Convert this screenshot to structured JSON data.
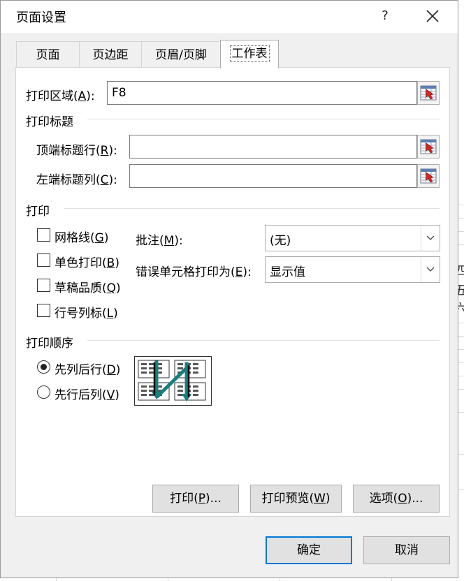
{
  "dialog": {
    "title": "页面设置",
    "help": "?",
    "close": "✕"
  },
  "tabs": [
    {
      "label": "页面"
    },
    {
      "label": "页边距"
    },
    {
      "label": "页眉/页脚"
    },
    {
      "label": "工作表"
    }
  ],
  "active_tab": "工作表",
  "print_area": {
    "label_pre": "打印区域(",
    "label_key": "A",
    "label_post": "):",
    "value": "F8"
  },
  "print_titles": {
    "heading": "打印标题",
    "rows_label_pre": "顶端标题行(",
    "rows_label_key": "R",
    "rows_label_post": "):",
    "rows_value": "",
    "cols_label_pre": "左端标题列(",
    "cols_label_key": "C",
    "cols_label_post": "):",
    "cols_value": ""
  },
  "print": {
    "heading": "打印",
    "gridlines": {
      "pre": "网格线(",
      "key": "G",
      "post": ")",
      "checked": false
    },
    "black_white": {
      "pre": "单色打印(",
      "key": "B",
      "post": ")",
      "checked": false
    },
    "draft": {
      "pre": "草稿品质(",
      "key": "Q",
      "post": ")",
      "checked": false
    },
    "headings": {
      "pre": "行号列标(",
      "key": "L",
      "post": ")",
      "checked": false
    },
    "comments_label_pre": "批注(",
    "comments_label_key": "M",
    "comments_label_post": "):",
    "comments_value": "(无)",
    "errors_label_pre": "错误单元格打印为(",
    "errors_label_key": "E",
    "errors_label_post": "):",
    "errors_value": "显示值"
  },
  "order": {
    "heading": "打印顺序",
    "down_then_over": {
      "pre": "先列后行(",
      "key": "D",
      "post": ")",
      "checked": true
    },
    "over_then_down": {
      "pre": "先行后列(",
      "key": "V",
      "post": ")",
      "checked": false
    }
  },
  "buttons": {
    "print": {
      "pre": "打印(",
      "key": "P",
      "post": ")..."
    },
    "preview": {
      "pre": "打印预览(",
      "key": "W",
      "post": ")"
    },
    "options": {
      "pre": "选项(",
      "key": "O",
      "post": ")..."
    },
    "ok": "确定",
    "cancel": "取消"
  },
  "background_sheet_text": [
    "四",
    "五",
    "六"
  ],
  "colors": {
    "dialog_bg": "#f0f0f0",
    "default_button_border": "#0078d7",
    "order_arrow": "#1a7f7f"
  }
}
